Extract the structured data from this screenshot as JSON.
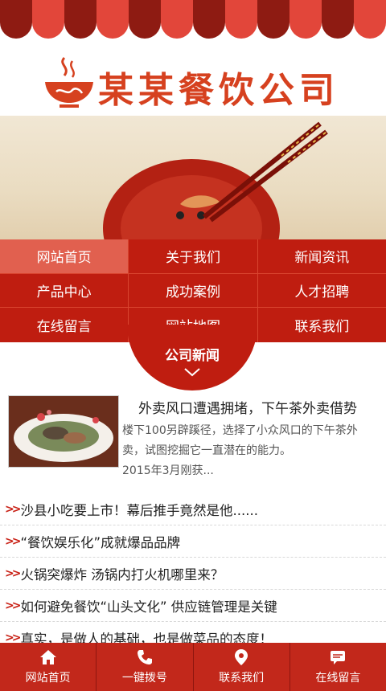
{
  "header": {
    "company_name": "某某餐饮公司"
  },
  "nav": {
    "rows": [
      [
        "网站首页",
        "关于我们",
        "新闻资讯"
      ],
      [
        "产品中心",
        "成功案例",
        "人才招聘"
      ],
      [
        "在线留言",
        "网站地图",
        "联系我们"
      ]
    ],
    "active": "网站首页",
    "section_tab": "公司新闻"
  },
  "featured": {
    "title": "外卖风口遭遇拥堵，下午茶外卖借势",
    "desc": "楼下100另辟蹊径，选择了小众风口的下午茶外卖，试图挖掘它一直潜在的能力。",
    "date_snippet": "2015年3月刚获..."
  },
  "news": [
    "沙县小吃要上市！幕后推手竟然是他......",
    "“餐饮娱乐化”成就爆品品牌",
    "火锅突爆炸 汤锅内打火机哪里来？",
    "如何避免餐饮“山头文化” 供应链管理是关键",
    "真实，是做人的基础，也是做菜品的态度！"
  ],
  "bottom_bar": [
    {
      "label": "网站首页",
      "icon": "home-icon"
    },
    {
      "label": "一键拨号",
      "icon": "phone-icon"
    },
    {
      "label": "联系我们",
      "icon": "location-pin-icon"
    },
    {
      "label": "在线留言",
      "icon": "message-icon"
    }
  ],
  "colors": {
    "primary": "#bf1d10",
    "awning_dark": "#8e1b12",
    "awning_light": "#e2463a",
    "logo": "#d6411f"
  }
}
